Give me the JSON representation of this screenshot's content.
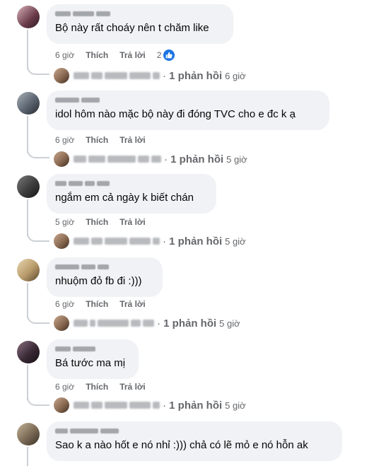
{
  "labels": {
    "like": "Thích",
    "reply": "Trả lời"
  },
  "comments": [
    {
      "text": "Bộ này rất choáy nên t chăm like",
      "time": "6 giờ",
      "reaction_count": "2",
      "reply_summary": "1 phản hồi",
      "reply_time": "6 giờ",
      "avatar_color": "#6b3a4a"
    },
    {
      "text": "idol hôm nào mặc bộ này đi đóng TVC cho e đc k ạ",
      "time": "6 giờ",
      "reply_summary": "1 phản hồi",
      "reply_time": "5 giờ",
      "avatar_color": "#5b6470"
    },
    {
      "text": "ngắm em cả ngày k biết chán",
      "time": "5 giờ",
      "reply_summary": "1 phản hồi",
      "reply_time": "5 giờ",
      "avatar_color": "#3c3c3c"
    },
    {
      "text": "nhuộm đỏ fb đi :)))",
      "time": "6 giờ",
      "reply_summary": "1 phản hồi",
      "reply_time": "5 giờ",
      "avatar_color": "#b79a6a"
    },
    {
      "text": "Bá tước ma mị",
      "time": "6 giờ",
      "reply_summary": "1 phản hồi",
      "reply_time": "5 giờ",
      "avatar_color": "#3a2a36"
    },
    {
      "text": "Sao k a nào hốt e nó nhỉ :))) chả có lẽ mỏ e nó hỗn ak",
      "time": "",
      "avatar_color": "#7a6a55"
    }
  ],
  "reply_avatar_color": "#8a6a52",
  "colors": {
    "bubble": "#f0f2f5",
    "secondary_text": "#65676b",
    "like_blue": "#1b74e4",
    "thread_line": "#ccd0d5"
  }
}
